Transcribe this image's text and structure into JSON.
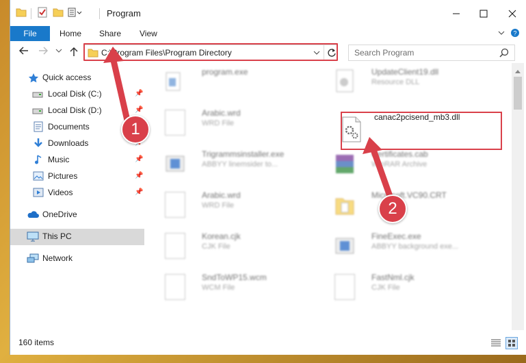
{
  "window": {
    "title": "Program"
  },
  "ribbon": {
    "tabs": [
      "File",
      "Home",
      "Share",
      "View"
    ]
  },
  "address": {
    "path": "C:\\Program Files\\Program Directory"
  },
  "search": {
    "placeholder": "Search Program"
  },
  "nav": {
    "items": [
      {
        "label": "Quick access"
      },
      {
        "label": "Local Disk (C:)"
      },
      {
        "label": "Local Disk (D:)"
      },
      {
        "label": "Documents"
      },
      {
        "label": "Downloads"
      },
      {
        "label": "Music"
      },
      {
        "label": "Pictures"
      },
      {
        "label": "Videos"
      },
      {
        "label": "OneDrive"
      },
      {
        "label": "This PC"
      },
      {
        "label": "Network"
      }
    ]
  },
  "files": [
    {
      "name": "program.exe",
      "type": ""
    },
    {
      "name": "UpdateClient19.dll",
      "type": "Resource DLL"
    },
    {
      "name": "Arabic.wrd",
      "type": "WRD File"
    },
    {
      "name": "canac2pcisend_mb3.dll",
      "type": ""
    },
    {
      "name": "Trigrammsinstaller.exe",
      "type": "ABBYY linemsider to..."
    },
    {
      "name": "Certificates.cab",
      "type": "WinRAR Archive"
    },
    {
      "name": "Arabic.wrd",
      "type": "WRD File"
    },
    {
      "name": "Microsoft.VC90.CRT",
      "type": ""
    },
    {
      "name": "Korean.cjk",
      "type": "CJK File"
    },
    {
      "name": "FineExec.exe",
      "type": "ABBYY background exe..."
    },
    {
      "name": "SndToWP15.wcm",
      "type": "WCM File"
    },
    {
      "name": "FastNml.cjk",
      "type": "CJK File"
    }
  ],
  "status": {
    "count": "160 items"
  },
  "annotations": {
    "step1": "1",
    "step2": "2"
  },
  "colors": {
    "accent": "#1979ca",
    "highlight": "#d9404a"
  }
}
